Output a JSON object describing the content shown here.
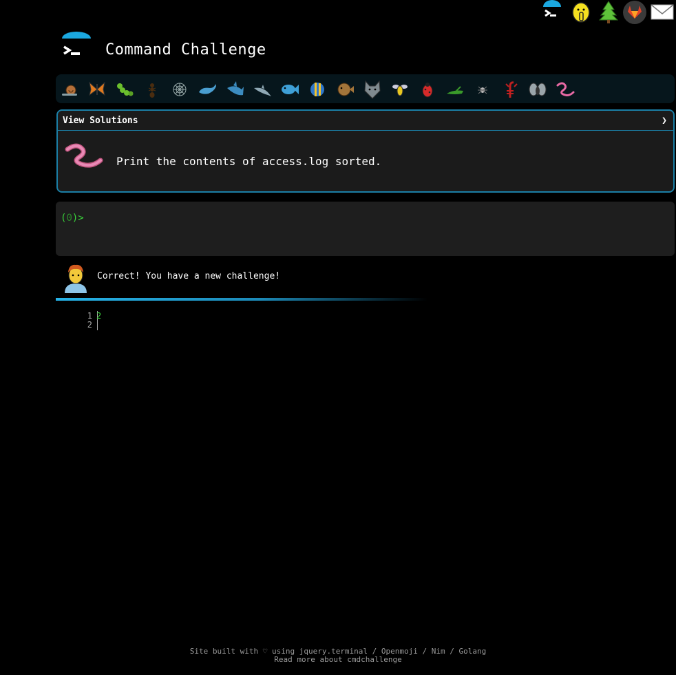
{
  "header": {
    "title": "Command Challenge",
    "logo_icon": "terminal-prompt-icon"
  },
  "top_links": [
    {
      "name": "cmdchallenge-home-icon"
    },
    {
      "name": "shushing-face-icon"
    },
    {
      "name": "evergreen-tree-icon"
    },
    {
      "name": "gitlab-icon"
    },
    {
      "name": "envelope-icon"
    }
  ],
  "critters": [
    "snail",
    "butterfly",
    "caterpillar",
    "ant",
    "spider-web",
    "whale",
    "shark",
    "dolphin",
    "fish",
    "tropical-fish",
    "blowfish",
    "wolf",
    "bee",
    "lady-beetle",
    "cricket",
    "spider",
    "scorpion",
    "fly",
    "worm"
  ],
  "solutions": {
    "label": "View Solutions",
    "toggle_glyph": "❯"
  },
  "challenge": {
    "icon": "worm-icon",
    "text": "Print the contents of access.log sorted."
  },
  "terminal": {
    "prompt_open": "(",
    "prompt_count": "0",
    "prompt_close": ")>"
  },
  "feedback": {
    "avatar": "person-red-hair-icon",
    "message": "Correct! You have a new challenge!"
  },
  "output": {
    "line_numbers": [
      "1",
      "2"
    ],
    "lines": [
      "2",
      ""
    ]
  },
  "footer": {
    "line1": "Site built with ♡ using jquery.terminal / Openmoji / Nim / Golang",
    "line2": "Read more about cmdchallenge"
  },
  "colors": {
    "accent": "#1b7fa6",
    "terminal_green": "#39d33a",
    "background": "#000000"
  }
}
